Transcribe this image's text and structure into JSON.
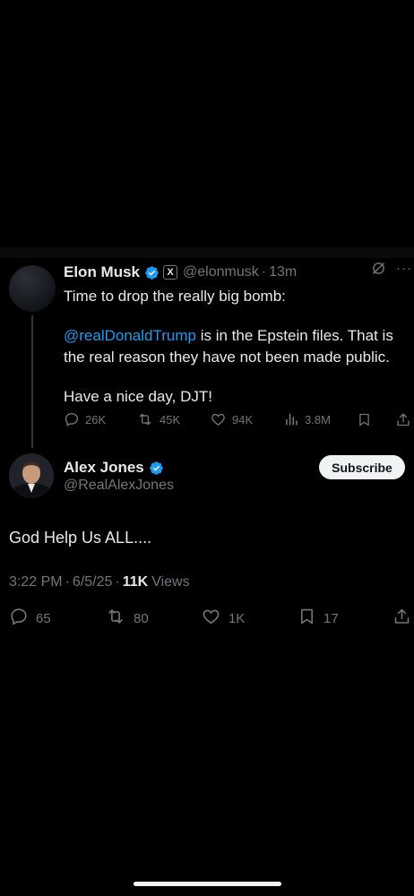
{
  "parent_tweet": {
    "author_name": "Elon Musk",
    "handle": "@elonmusk",
    "time": "13m",
    "separator": "·",
    "verified_badge": "verified-icon",
    "affiliate_badge": "X",
    "more_label": "···",
    "text_line1": "Time to drop the really big bomb:",
    "mention": "@realDonaldTrump",
    "text_after_mention": " is in the Epstein files. That is the real reason they have not been made public.",
    "text_line3": "Have a nice day, DJT!",
    "actions": {
      "replies": "26K",
      "reposts": "45K",
      "likes": "94K",
      "views": "3.8M"
    }
  },
  "main_tweet": {
    "author_name": "Alex Jones",
    "handle": "@RealAlexJones",
    "subscribe_label": "Subscribe",
    "text": "God Help Us ALL....",
    "time": "3:22 PM",
    "date": "6/5/25",
    "separator": "·",
    "views_count": "11K",
    "views_label": "Views",
    "actions": {
      "replies": "65",
      "reposts": "80",
      "likes": "1K",
      "bookmarks": "17"
    }
  },
  "colors": {
    "background": "#000000",
    "text_primary": "#e7e9ea",
    "text_secondary": "#71767b",
    "accent_blue": "#1d9bf0",
    "subscribe_bg": "#eff3f4"
  }
}
